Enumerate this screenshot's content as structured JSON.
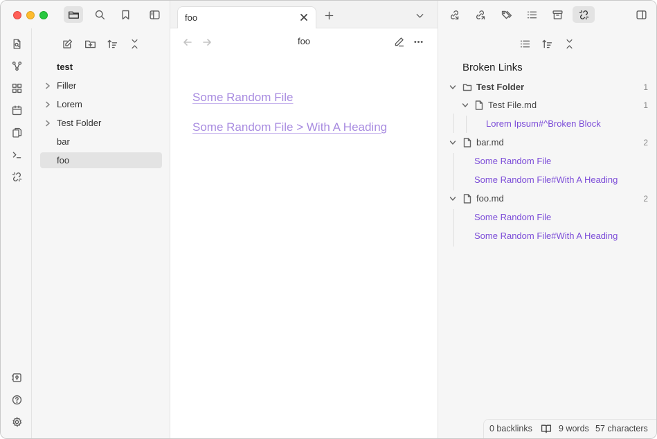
{
  "tabs": [
    {
      "label": "foo"
    }
  ],
  "file_tree": {
    "root": "test",
    "items": [
      {
        "label": "Filler",
        "type": "folder"
      },
      {
        "label": "Lorem",
        "type": "folder"
      },
      {
        "label": "Test Folder",
        "type": "folder"
      },
      {
        "label": "bar",
        "type": "file"
      },
      {
        "label": "foo",
        "type": "file",
        "selected": true
      }
    ]
  },
  "editor": {
    "title": "foo",
    "links": [
      "Some Random File",
      "Some Random File > With A Heading"
    ]
  },
  "broken_links": {
    "title": "Broken Links",
    "groups": [
      {
        "label": "Test Folder",
        "count": "1"
      },
      {
        "label": "Test File.md",
        "count": "1"
      },
      {
        "label": "Lorem Ipsum#^Broken Block"
      },
      {
        "label": "bar.md",
        "count": "2"
      },
      {
        "label": "Some Random File"
      },
      {
        "label": "Some Random File#With A Heading"
      },
      {
        "label": "foo.md",
        "count": "2"
      },
      {
        "label": "Some Random File"
      },
      {
        "label": "Some Random File#With A Heading"
      }
    ]
  },
  "status": {
    "backlinks": "0 backlinks",
    "words": "9 words",
    "characters": "57 characters"
  },
  "colors": {
    "link": "#7c4dd8",
    "editor_link": "#a88be0"
  }
}
